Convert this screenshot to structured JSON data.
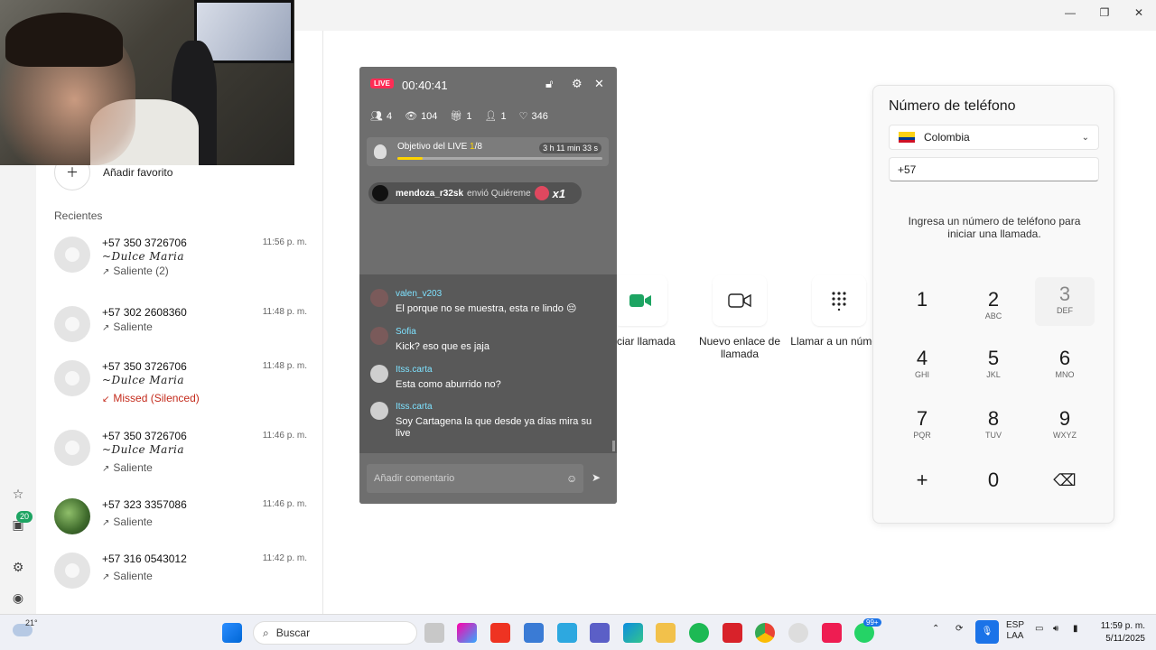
{
  "window": {
    "minimize": "—",
    "maximize": "❐",
    "close": "✕"
  },
  "sidebar": {
    "badge": "20"
  },
  "left_panel": {
    "favorite_label": "Añadir favorito",
    "recent_title": "Recientes",
    "calls": [
      {
        "number": "+57 350 3726706",
        "name": "~Dulce Maria",
        "status": "Saliente (2)",
        "time": "11:56 p. m.",
        "missed": false
      },
      {
        "number": "+57 302 2608360",
        "name": "",
        "status": "Saliente",
        "time": "11:48 p. m.",
        "missed": false
      },
      {
        "number": "+57 350 3726706",
        "name": "~Dulce Maria",
        "status": "Missed (Silenced)",
        "time": "11:48 p. m.",
        "missed": true
      },
      {
        "number": "+57 350 3726706",
        "name": "~Dulce Maria",
        "status": "Saliente",
        "time": "11:46 p. m.",
        "missed": false
      },
      {
        "number": "+57 323 3357086",
        "name": "",
        "status": "Saliente",
        "time": "11:46 p. m.",
        "missed": false
      },
      {
        "number": "+57 316 0543012",
        "name": "",
        "status": "Saliente",
        "time": "11:42 p. m.",
        "missed": false
      }
    ]
  },
  "actions": [
    {
      "label": "Iniciar llamada",
      "icon": "video-icon"
    },
    {
      "label": "Nuevo enlace de llamada",
      "icon": "video-link-icon"
    },
    {
      "label": "Llamar a un número",
      "icon": "dialpad-icon"
    }
  ],
  "dialer": {
    "title": "Número de teléfono",
    "country": "Colombia",
    "phone_value": "+57",
    "hint": "Ingresa un número de teléfono para iniciar una llamada.",
    "keys": [
      {
        "digit": "1",
        "letters": ""
      },
      {
        "digit": "2",
        "letters": "ABC"
      },
      {
        "digit": "3",
        "letters": "DEF"
      },
      {
        "digit": "4",
        "letters": "GHI"
      },
      {
        "digit": "5",
        "letters": "JKL"
      },
      {
        "digit": "6",
        "letters": "MNO"
      },
      {
        "digit": "7",
        "letters": "PQR"
      },
      {
        "digit": "8",
        "letters": "TUV"
      },
      {
        "digit": "9",
        "letters": "WXYZ"
      },
      {
        "digit": "+",
        "letters": ""
      },
      {
        "digit": "0",
        "letters": ""
      },
      {
        "digit": "⌫",
        "letters": ""
      }
    ]
  },
  "live": {
    "badge": "LIVE",
    "timer": "00:40:41",
    "stats": {
      "guests": "4",
      "viewers": "104",
      "gifts": "1",
      "new_followers": "1",
      "likes": "346"
    },
    "goal": {
      "label_prefix": "Objetivo del LIVE ",
      "current": "1",
      "total": "/8",
      "timer": "3 h 11 min 33 s",
      "progress": 0.125
    },
    "gift": {
      "user": "mendoza_r32sk",
      "action": "envió Quiéreme",
      "count": "x1"
    },
    "messages": [
      {
        "user": "valen_v203",
        "text": "El porque no se muestra, esta re lindo 😔"
      },
      {
        "user": "Sofia",
        "text": "Kick? eso que es jaja"
      },
      {
        "user": "Itss.carta",
        "text": "Esta como aburrido no?"
      },
      {
        "user": "Itss.carta",
        "text": "Soy Cartagena la que desde ya días mira su live"
      }
    ],
    "comment_placeholder": "Añadir comentario"
  },
  "taskbar": {
    "weather_temp": "21°",
    "search_label": "Buscar",
    "whatsapp_badge": "99+",
    "lang_top": "ESP",
    "lang_bottom": "LAA",
    "time": "11:59 p. m.",
    "date": "5/11/2025"
  }
}
